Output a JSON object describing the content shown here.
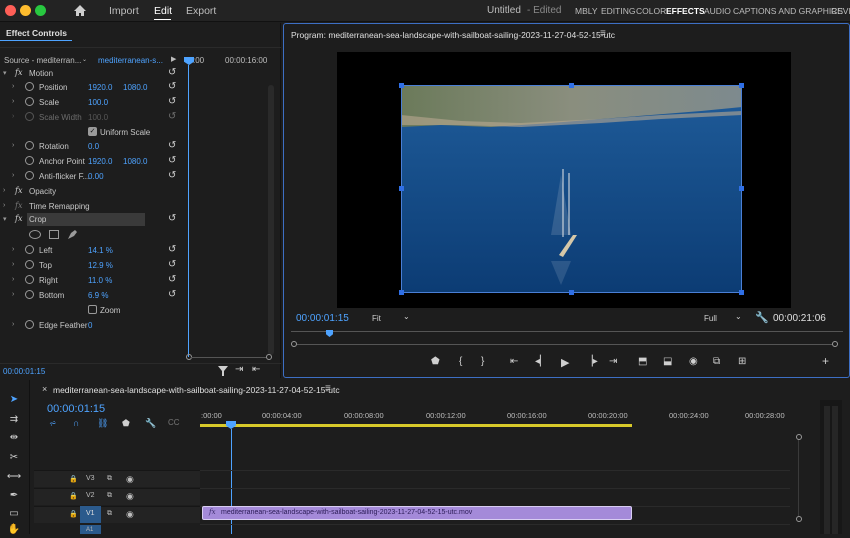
{
  "menu": {
    "import": "Import",
    "edit": "Edit",
    "export": "Export",
    "title": "Untitled",
    "title_status": "- Edited"
  },
  "workspaces": [
    "MBLY",
    "EDITING",
    "COLOR",
    "EFFECTS",
    "AUDIO",
    "CAPTIONS AND GRAPHICS",
    "REVIE"
  ],
  "effect_controls": {
    "tab": "Effect Controls",
    "source": "Source - mediterran...",
    "clip": "mediterranean-s...",
    "time0": ":00",
    "time1": "00:00:16:00",
    "motion": "Motion",
    "position": {
      "label": "Position",
      "x": "1920.0",
      "y": "1080.0"
    },
    "scale": {
      "label": "Scale",
      "value": "100.0"
    },
    "scale_width": {
      "label": "Scale Width",
      "value": "100.0"
    },
    "uniform_scale": "Uniform Scale",
    "rotation": {
      "label": "Rotation",
      "value": "0.0"
    },
    "anchor": {
      "label": "Anchor Point",
      "x": "1920.0",
      "y": "1080.0"
    },
    "antiflicker": {
      "label": "Anti-flicker F...",
      "value": "0.00"
    },
    "opacity": "Opacity",
    "time_remap": "Time Remapping",
    "crop": "Crop",
    "left": {
      "label": "Left",
      "value": "14.1 %"
    },
    "top": {
      "label": "Top",
      "value": "12.9 %"
    },
    "right": {
      "label": "Right",
      "value": "11.0 %"
    },
    "bottom": {
      "label": "Bottom",
      "value": "6.9 %"
    },
    "zoom": "Zoom",
    "edge_feather": {
      "label": "Edge Feather",
      "value": "0"
    },
    "timecode": "00:00:01:15"
  },
  "program": {
    "title": "Program: mediterranean-sea-landscape-with-sailboat-sailing-2023-11-27-04-52-15-utc",
    "timecode": "00:00:01:15",
    "fit": "Fit",
    "quality": "Full",
    "duration": "00:00:21:06"
  },
  "timeline": {
    "tab": "mediterranean-sea-landscape-with-sailboat-sailing-2023-11-27-04-52-15-utc",
    "timecode": "00:00:01:15",
    "ruler": [
      ":00:00",
      "00:00:04:00",
      "00:00:08:00",
      "00:00:12:00",
      "00:00:16:00",
      "00:00:20:00",
      "00:00:24:00",
      "00:00:28:00"
    ],
    "tracks": [
      "V3",
      "V2",
      "V1",
      "A1"
    ],
    "clip": "mediterranean-sea-landscape-with-sailboat-sailing-2023-11-27-04-52-15-utc.mov"
  },
  "colors": {
    "accent": "#4ea3ff",
    "clip": "#a48ad9",
    "handle": "#2f6fe6"
  }
}
